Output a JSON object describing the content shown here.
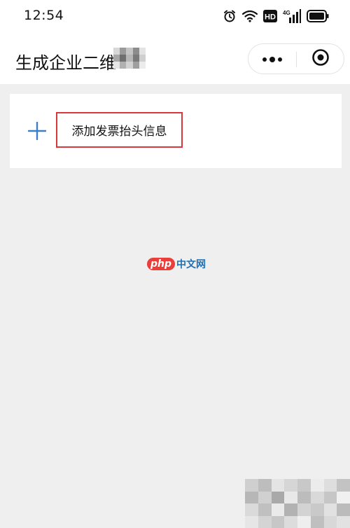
{
  "status_bar": {
    "time": "12:54",
    "icons": [
      "alarm-icon",
      "wifi-icon",
      "hd-icon",
      "signal-4g-icon",
      "battery-icon"
    ],
    "hd_label": "HD",
    "network_label": "4G"
  },
  "nav": {
    "title": "生成企业二维",
    "more_icon": "more-dots-icon",
    "close_icon": "target-close-icon"
  },
  "card": {
    "add_icon": "plus-icon",
    "add_label": "添加发票抬头信息"
  },
  "watermark": {
    "logo": "php",
    "text": "中文网"
  },
  "colors": {
    "background": "#efefef",
    "surface": "#ffffff",
    "accent": "#3a7fc8",
    "highlight_border": "#d9363e"
  }
}
